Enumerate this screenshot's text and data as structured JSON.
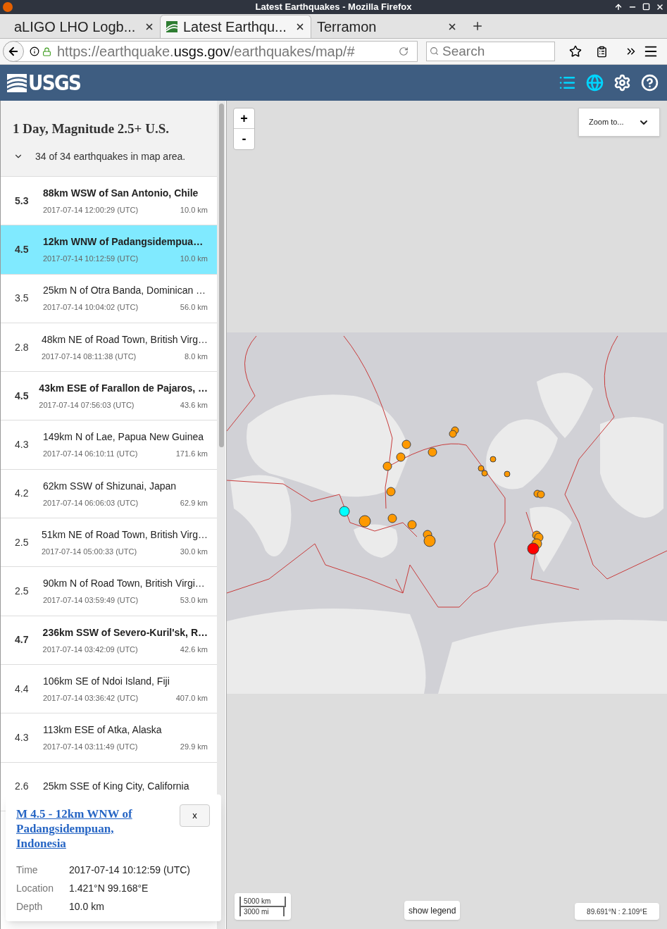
{
  "window": {
    "title": "Latest Earthquakes - Mozilla Firefox"
  },
  "browser": {
    "tabs": [
      {
        "label": "aLIGO LHO Logb...",
        "selected": false,
        "kind": "plain"
      },
      {
        "label": "Latest Earthqu...",
        "selected": true,
        "kind": "usgs"
      },
      {
        "label": "Terramon",
        "selected": false,
        "kind": "plain"
      }
    ],
    "url": {
      "prefix": "https://earthquake.",
      "domain": "usgs.gov",
      "path": "/earthquakes/map/#"
    },
    "search": {
      "placeholder": "Search"
    }
  },
  "header": {
    "logo": "USGS",
    "buttons": [
      {
        "kind": "list",
        "selected": true
      },
      {
        "kind": "globe",
        "selected": true
      },
      {
        "kind": "settings",
        "selected": false
      },
      {
        "kind": "help",
        "selected": false
      }
    ]
  },
  "sidebar": {
    "title": "1 Day, Magnitude 2.5+ U.S.",
    "summary": "34 of 34 earthquakes in map area.",
    "events": [
      {
        "magnitude": "5.3",
        "place": "88km WSW of San Antonio, Chile",
        "time": "2017-07-14 12:00:29 (UTC)",
        "depth": "10.0 km",
        "significant": true,
        "selected": false
      },
      {
        "magnitude": "4.5",
        "place": "12km WNW of Padangsidempua…",
        "time": "2017-07-14 10:12:59 (UTC)",
        "depth": "10.0 km",
        "significant": true,
        "selected": true
      },
      {
        "magnitude": "3.5",
        "place": "25km N of Otra Banda, Dominican …",
        "time": "2017-07-14 10:04:02 (UTC)",
        "depth": "56.0 km",
        "significant": false,
        "selected": false
      },
      {
        "magnitude": "2.8",
        "place": "48km NE of Road Town, British Virg…",
        "time": "2017-07-14 08:11:38 (UTC)",
        "depth": "8.0 km",
        "significant": false,
        "selected": false
      },
      {
        "magnitude": "4.5",
        "place": "43km ESE of Farallon de Pajaros, …",
        "time": "2017-07-14 07:56:03 (UTC)",
        "depth": "43.6 km",
        "significant": true,
        "selected": false
      },
      {
        "magnitude": "4.3",
        "place": "149km N of Lae, Papua New Guinea",
        "time": "2017-07-14 06:10:11 (UTC)",
        "depth": "171.6 km",
        "significant": false,
        "selected": false
      },
      {
        "magnitude": "4.2",
        "place": "62km SSW of Shizunai, Japan",
        "time": "2017-07-14 06:06:03 (UTC)",
        "depth": "62.9 km",
        "significant": false,
        "selected": false
      },
      {
        "magnitude": "2.5",
        "place": "51km NE of Road Town, British Virg…",
        "time": "2017-07-14 05:00:33 (UTC)",
        "depth": "30.0 km",
        "significant": false,
        "selected": false
      },
      {
        "magnitude": "2.5",
        "place": "90km N of Road Town, British Virgi…",
        "time": "2017-07-14 03:59:49 (UTC)",
        "depth": "53.0 km",
        "significant": false,
        "selected": false
      },
      {
        "magnitude": "4.7",
        "place": "236km SSW of Severo-Kuril'sk, R…",
        "time": "2017-07-14 03:42:09 (UTC)",
        "depth": "42.6 km",
        "significant": true,
        "selected": false
      },
      {
        "magnitude": "4.4",
        "place": "106km SE of Ndoi Island, Fiji",
        "time": "2017-07-14 03:36:42 (UTC)",
        "depth": "407.0 km",
        "significant": false,
        "selected": false
      },
      {
        "magnitude": "4.3",
        "place": "113km ESE of Atka, Alaska",
        "time": "2017-07-14 03:11:49 (UTC)",
        "depth": "29.9 km",
        "significant": false,
        "selected": false
      },
      {
        "magnitude": "2.6",
        "place": "25km SSE of King City, California",
        "significant": false,
        "selected": false
      }
    ]
  },
  "map": {
    "zoom_in": "+",
    "zoom_out": "-",
    "zoom_to": "Zoom to...",
    "scale": [
      "5000 km",
      "3000 mi"
    ],
    "legend_button": "show legend",
    "coordinates": "89.691°N : 2.109°E"
  },
  "popup": {
    "title": "M 4.5 - 12km WNW of Padangsidempuan, Indonesia",
    "close": "x",
    "details": [
      {
        "label": "Time",
        "value": "2017-07-14 10:12:59 (UTC)"
      },
      {
        "label": "Location",
        "value": "1.421°N 99.168°E"
      },
      {
        "label": "Depth",
        "value": "10.0 km"
      }
    ]
  }
}
